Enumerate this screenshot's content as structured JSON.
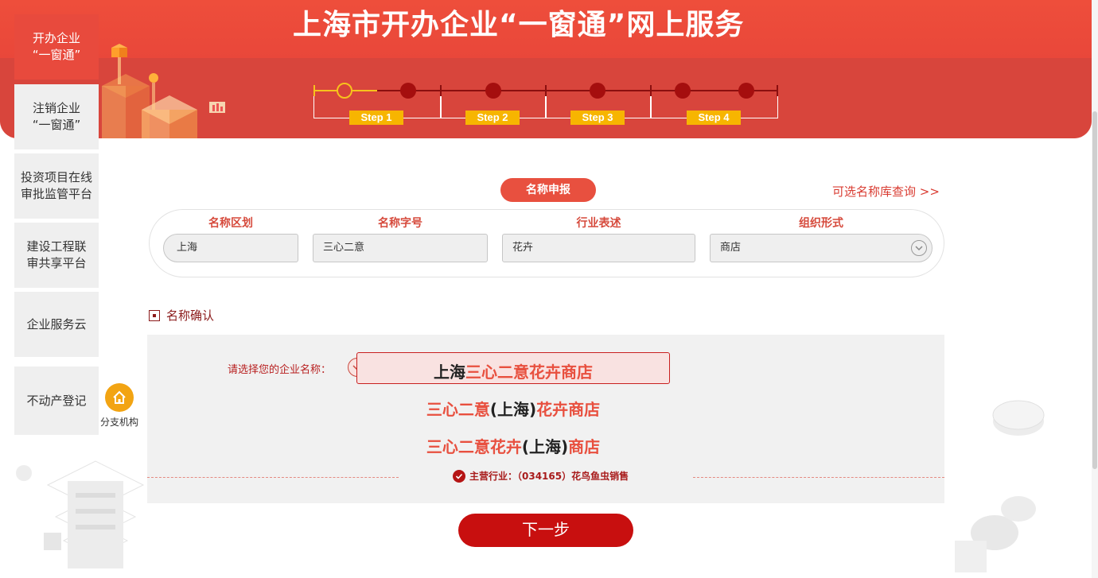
{
  "banner": {
    "title": "上海市开办企业“一窗通”网上服务",
    "steps": [
      "Step 1",
      "Step 2",
      "Step 3",
      "Step 4"
    ]
  },
  "sidebar": {
    "items": [
      {
        "label": "开办企业\n“一窗通”"
      },
      {
        "label": "注销企业\n“一窗通”"
      },
      {
        "label": "投资项目在线\n审批监管平台"
      },
      {
        "label": "建设工程联\n审共享平台"
      },
      {
        "label": "企业服务云"
      },
      {
        "label": "不动产登记"
      }
    ],
    "branch_label": "分支机构",
    "branch_icon": "home-icon"
  },
  "name_declare": {
    "pill": "名称申报",
    "library_link": "可选名称库查询 >>",
    "fields": [
      {
        "label": "名称区划",
        "value": "上海"
      },
      {
        "label": "名称字号",
        "value": "三心二意"
      },
      {
        "label": "行业表述",
        "value": "花卉"
      },
      {
        "label": "组织形式",
        "value": "商店"
      }
    ]
  },
  "name_confirm": {
    "title": "名称确认",
    "choose_label": "请选择您的企业名称：",
    "options": [
      {
        "parts": [
          "上海",
          "三心二意花卉商店"
        ]
      },
      {
        "parts": [
          "三心二意",
          "(上海)",
          "花卉商店"
        ]
      },
      {
        "parts": [
          "三心二意花卉",
          "(上海)",
          "商店"
        ]
      }
    ],
    "industry": "主营行业：（034165）花鸟鱼虫销售"
  },
  "next_button": "下一步",
  "colors": {
    "brand_red": "#e8503f",
    "dark_red": "#c80f0f",
    "gold": "#f7b500",
    "orange": "#f2a413"
  }
}
